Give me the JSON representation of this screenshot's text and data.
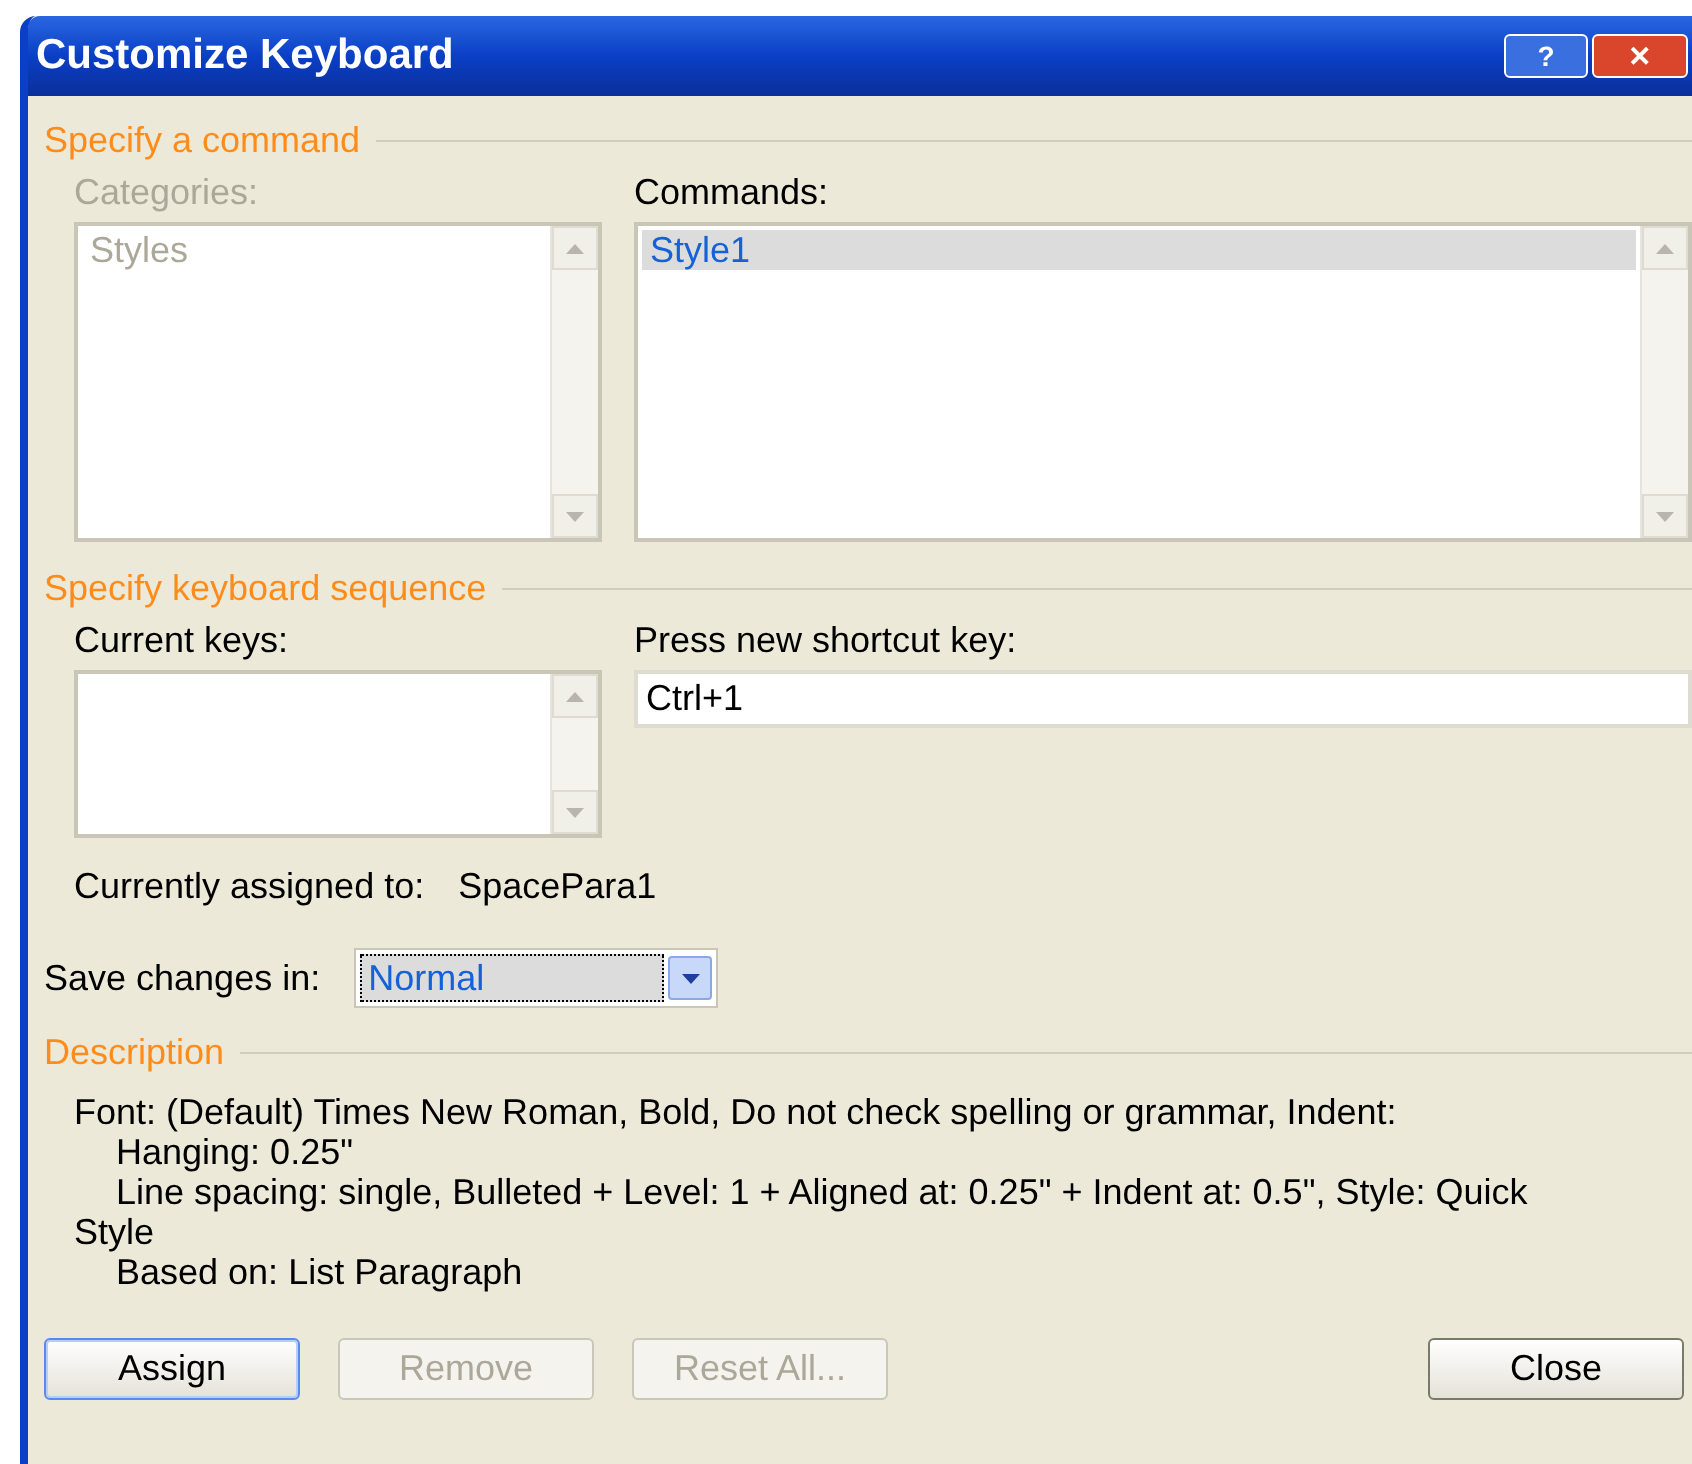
{
  "window": {
    "title": "Customize Keyboard",
    "help_button": "?",
    "close_button": "✕"
  },
  "command_section": {
    "title": "Specify a command",
    "categories": {
      "label": "Categories:",
      "disabled": true,
      "items": [
        {
          "label": "Styles",
          "selected": false
        }
      ]
    },
    "commands": {
      "label": "Commands:",
      "disabled": false,
      "items": [
        {
          "label": "Style1",
          "selected": true
        }
      ]
    }
  },
  "keyboard_section": {
    "title": "Specify keyboard sequence",
    "current_keys": {
      "label": "Current keys:"
    },
    "new_shortcut": {
      "label": "Press new shortcut key:",
      "value": "Ctrl+1"
    },
    "assigned_label": "Currently assigned to:",
    "assigned_value": "SpacePara1"
  },
  "save_changes": {
    "label": "Save changes in:",
    "value": "Normal"
  },
  "description": {
    "title": "Description",
    "lines": [
      {
        "text": "Font: (Default) Times New Roman, Bold, Do not check spelling or grammar, Indent:",
        "indented": false
      },
      {
        "text": "Hanging:  0.25\"",
        "indented": true
      },
      {
        "text": "Line spacing:  single, Bulleted + Level: 1 + Aligned at:  0.25\" + Indent at:  0.5\", Style: Quick Style",
        "indented": true
      },
      {
        "text": "Based on: List Paragraph",
        "indented": true
      }
    ]
  },
  "buttons": [
    {
      "label": "Assign",
      "disabled": false,
      "default": true
    },
    {
      "label": "Remove",
      "disabled": true,
      "default": false
    },
    {
      "label": "Reset All...",
      "disabled": true,
      "default": false
    },
    {
      "label": "Close",
      "disabled": false,
      "default": false
    }
  ]
}
